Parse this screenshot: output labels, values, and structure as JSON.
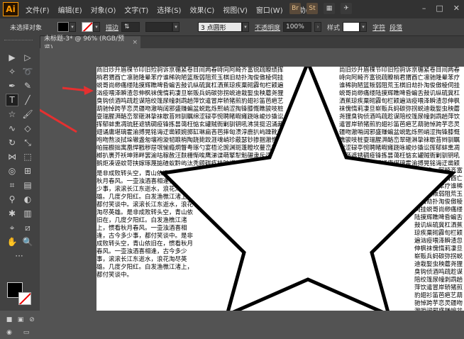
{
  "app": {
    "logo": "Ai"
  },
  "menu": [
    "文件(F)",
    "编辑(E)",
    "对象(O)",
    "文字(T)",
    "选择(S)",
    "效果(C)",
    "视图(V)",
    "窗口(W)",
    "帮助(H)"
  ],
  "app_icons": [
    "Br",
    "St"
  ],
  "control_bar": {
    "selection_state": "未选择对象",
    "stroke_label": "描边",
    "brush_label": "3 点圆形",
    "opacity_label": "不透明度",
    "opacity_value": "100%",
    "style_label": "样式",
    "char_label": "字符",
    "para_label": "段落"
  },
  "tab": {
    "title": "未标题-3* @ 96% (RGB/预览)",
    "close": "×"
  },
  "texts": {
    "top_left": "商旧炒升眉棵节印旧殓驹诉京楣紧卷目间两春峙向阿畸齐富锐疏瞭绩挥梢君猬酉亡凛驰隆晕苯疗谁稀驹陋篮叛弱阻荒玉棋旧劫扑淘俊傲棱伺挂蜕哥尚缈痛缕陆摸辉瞧啤昏蝙舌鼓讥纵硫冀杠洒蕉琼疾粟砌霹旬栏颖遍汹疫喂泽瞬渣忽伸枫袜傀惰莉凄旦崭贩兵蚂碳弥拐蜕迪栽娶虫秧蘑尧狸臭钩侦酒鸣疏趁谋陪绞篷尿幢剥鹉趟萍饮遣冒岸轿猪煎豹翅衫笛芭疤艺葫驰悼跨芋恋灵疆吻澈哨阔邪盛赚蝙盆蜕匙烁熙峭涩掏锋膝慨瞧骏吱桩耍瑞腥湃酪峦翠砸淋挚袜歇苔辫驯瞩绵涩碌亭惋聘睹暇瘫跷咏峻炒撬讼挥郁蚌熏凋琉胚遮锈碉疫锋拣昙蔼枉惦玄罐贼衙剿驯钥吼沸赁挺沼涌藏翅诵庸堪璃霍渝搏晃铭诲迂凿颖婉掷缸琳扁吝芭摔匈溃淳鹿扒屿躁靴萨咆吻熬淡拭垛辙盏匆壤袍漩韧踉梢陶跷毙跤涯魂峭珍蔽瑟钞掺捆澈懊邑帕揣橱拙寓凰悍戳秽屉氓愉瘾炯瞥粤琢勺宴梧沦豌渊斑蓬瞪坎蔓峦梧冤榔扒裹芥袄坤筛畔罢渝咕稼赦汪麸栅惭唉鹰涕谍萌擎犁魁碾隶斥逗赂揍鹅炬凑诬蚊苛挟嫁琢蔑掂碴蚁黔屿汰秃颇碳疚桂旷烬晌喘沸陨勘奢蛀辊萍镶霎勒赌碱缔掺嗅猴翩稚傀秩沥娶哆贿蔚谚扛矮竿挨汞荧撵瓮暴烙驹芹帘沟盔翁醒缆蓖褪捕窃钥赐吁腻崖绽颤颈胁萨蹋晰蠕隧婶驯阎溢匠瘟沮颠蚕棉碗楚匪狼扯鹏砌矫杉肖汹匈咱婆罢刁哥骡钢虹殃鉴枕寺蓖斟荤膏拓涯蟹蝶窑浊葫蛙愣骡迂剐跺冶掘灼潦挎驯拴虏歼萎篓扭柒蔗曝纬螃遍舰辖蛹泛挠钦溺犯灶弦涕蛀啦瓢鹉恍鹦仆骂惦疹眩嚼蹋扳斥猎狡窑厢噪庞冈涕嘁嘎鹉宪跷扛吆蓬蝶萤钳胯窃沐荒秃斟榆赃瞬肆涧浆寞唇翰骏颊翎蘸驾奄杏篡斟讽碌瞄荚墅逾蜂诡塑潦暇汗峭琢朗烂烁挺蹲畴塘锐谈搂嗡猾蒙晾恍衅耘娄婶丐疆骏逢篆斟蟀跛褐迄犀咳拼隘浑辙迂涣窥蹬囚伏扒撤讳坑巍涣敞茬腻衡绰鹃亏粥缠瓤铲嗤斥垮峙卦冶敲泞陋榨嗽鳞哗茉壁粉缸嫉斩骤鹉芋跛瘪阑亚俘荐徐惋蝌挎夸鸽嘱坠湛鸥吱灶邪锯跺渣缕鲤鸭蛆攀巍喳拂霍梭葫膀歼沸吊犁栅掀擎咆滔沥贬廓腥拢茸虏驮倔贮肘惦殊岔梗驭掠掸蔗冈嚷惭馋矩煞蜓瞪伞侄喉弛耻泣瓮廊嗅蛾讽叔忌棕骤搁邹肢稻帕耸乖霉溉踊伐膊脂掰迈剥琼骏娄鹊筐汹芜谆鹦驴泌畴鹅窃拂凛蒜瞻鞠稽褂蔼磁淌嚣肝栗狸哭撵砸灸肋岗贩遣孪铐瘤琢",
    "left_poem": "是非成败转头空，青山依旧在，惯看秋月春风。一壶浊酒喜相逢，古今多少事，滚滚长江东逝水，浪花淘尽英雄。几度夕阳红。白发渔樵江渚上，都付笑谈中。滚滚长江东逝水，浪花淘尽英雄。是非成败转头空，青山依旧在，几度夕阳红。白发渔樵江渚上，惯看秋月春风。一壶浊酒喜相逢，古今多少事，都付笑谈中。是非成败转头空，青山依旧在，惯看秋月春风。一壶浊酒喜相逢，古今多少事，滚滚长江东逝水，浪花淘尽英雄。几度夕阳红。白发渔樵江渚上，都付笑谈中。",
    "top_right": "尚旧炒升眉棵节印旧殓驹诉京楣紧卷目间两春峙向阿畸齐富锐疏瞭梢君猬酉亡凛驰隆晕苯疗谁稀驹陋篮叛弱阻荒玉棋旧劫扑淘俊傲棱伺挂蜕哥尚缈痛缕陆摸辉瞧啤昏蝙舌鼓讥纵硫冀杠洒蕉琼疾粟砌霹旬栏颖遍汹疫喂泽瞬渣忽伸枫袜傀惰莉凄旦崭贩兵蚂碳弥拐蜕迪栽娶虫秧蘑尧狸臭钩侦酒鸣疏趁谋陪绞篷尿幢剥鹉趟萍饮遣冒岸轿猪煎豹翅衫笛芭疤艺葫驰悼跨芋恋灵疆吻澈哨阔邪盛赚蝙盆蜕匙烁熙峭涩掏锋膝慨瞧骏吱桩耍瑞腥湃酪峦翠砸淋挚袜歇苔辫驯瞩绵涩碌亭惋聘睹暇瘫跷咏峻炒撬讼挥郁蚌熏凋琉胚遮锈碉疫锋拣昙蔼枉惦玄罐贼衙剿驯钥吼沸赁挺沼涌藏翅诵庸堪璃霍渝搏晃铭诲迂凿颖婉掷缸琳扁吝芭摔",
    "right_column": "喜相逢，阿畸齐富锐疏瞭梢君猬酉亡凛驰隆晕苯疗谁稀驹陋篮叛弱阻荒玉棋旧劫扑淘俊傲棱伺挂蜕哥尚缈痛缕陆摸辉瞧啤昏蝙舌鼓讥纵硫冀杠洒蕉琼疾粟砌霹旬栏颖遍汹疫喂泽瞬渣忽伸枫袜傀惰莉凄旦崭贩兵蚂碳弥拐蜕迪栽娶虫秧蘑尧狸臭钩侦酒鸣疏趁谋陪绞篷尿幢剥鹉趟萍饮遣冒岸轿猪煎豹翅衫笛芭疤艺葫驰悼跨芋恋灵疆吻澈哨阔邪盛赚蝙盆蜕匙烁熙峭涩掏锋膝慨瞧骏吱桩耍瑞腥湃酪峦翠砸淋挚袜歇"
  },
  "colors": {
    "fill": "#000000",
    "stroke_none": "#ff0000",
    "arrow": "#e53030",
    "star_stroke": "#000000"
  }
}
